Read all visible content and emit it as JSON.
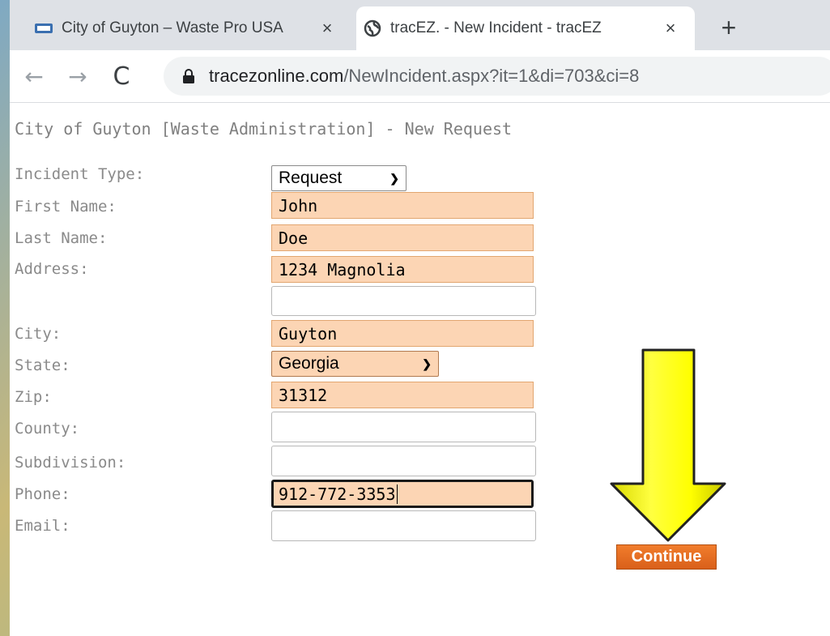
{
  "browser": {
    "tabs": [
      {
        "title": "City of Guyton – Waste Pro USA",
        "favicon": "flag-icon",
        "close": "×"
      },
      {
        "title": "tracEZ. - New Incident - tracEZ",
        "favicon": "globe-icon",
        "close": "×",
        "active": true
      }
    ],
    "new_tab": "+",
    "back": "←",
    "forward": "→",
    "reload": "C",
    "url_host": "tracezonline.com",
    "url_path": "/NewIncident.aspx?it=1&di=703&ci=8"
  },
  "form": {
    "title": "City of Guyton [Waste Administration] - New Request",
    "labels": {
      "incident_type": "Incident Type:",
      "first_name": "First Name:",
      "last_name": "Last Name:",
      "address": "Address:",
      "city": "City:",
      "state": "State:",
      "zip": "Zip:",
      "county": "County:",
      "subdivision": "Subdivision:",
      "phone": "Phone:",
      "email": "Email:"
    },
    "values": {
      "incident_type": "Request",
      "first_name": "John",
      "last_name": "Doe",
      "address1": "1234 Magnolia",
      "address2": "",
      "city": "Guyton",
      "state": "Georgia",
      "zip": "31312",
      "county": "",
      "subdivision": "",
      "phone": "912-772-3353",
      "email": ""
    },
    "continue_label": "Continue"
  },
  "colors": {
    "filled_field": "#fcd5b4",
    "continue_button": "#e86e22",
    "arrow": "#ffff00"
  }
}
